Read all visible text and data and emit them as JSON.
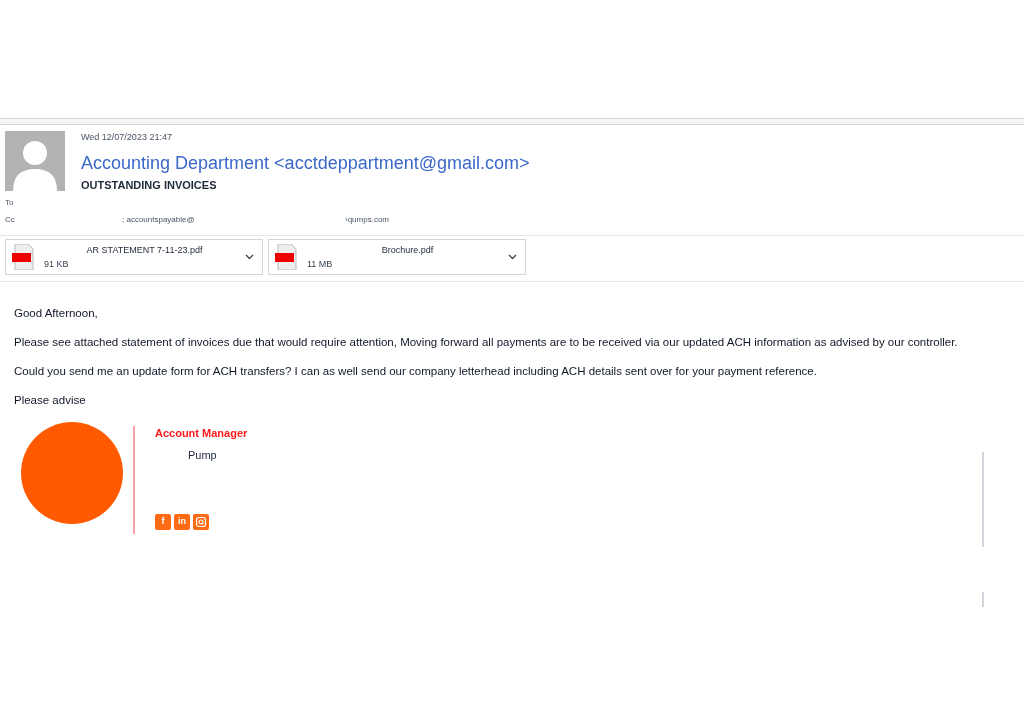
{
  "message": {
    "date": "Wed 12/07/2023 21:47",
    "sender": "Accounting Department <acctdeppartment@gmail.com>",
    "subject": "OUTSTANDING INVOICES",
    "to_label": "To",
    "cc_label": "Cc",
    "cc_parts": [
      "; accountspayable@",
      "›qumps.com"
    ]
  },
  "attachments": [
    {
      "name": "AR STATEMENT 7-11-23.pdf",
      "size": "91 KB"
    },
    {
      "name": "Brochure.pdf",
      "size": "11 MB"
    }
  ],
  "body": [
    "Good Afternoon,",
    "Please see attached statement of invoices due that would require attention, Moving forward all payments are to be received via our updated ACH information as advised by our controller.",
    "Could you send me an update form for ACH transfers? I can as well send our company letterhead including ACH details sent over for your payment reference.",
    "Please advise"
  ],
  "signature": {
    "title": "Account Manager",
    "company": "Pump",
    "social": [
      {
        "kind": "facebook",
        "label": "f"
      },
      {
        "kind": "linkedin",
        "label": "in"
      },
      {
        "kind": "instagram"
      }
    ]
  }
}
